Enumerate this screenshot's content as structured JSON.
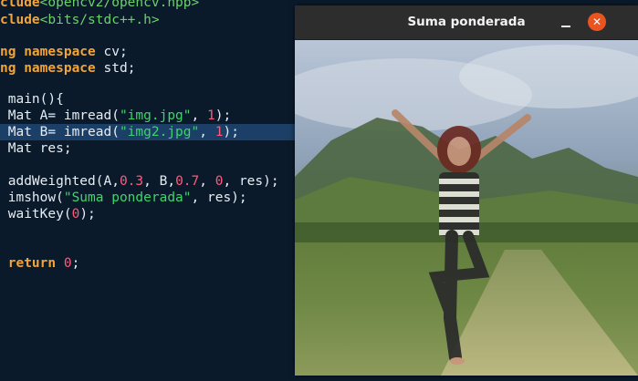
{
  "window": {
    "title": "Suma ponderada",
    "minimize_glyph": "–",
    "close_glyph": "✕",
    "close_color": "#e95420",
    "image_description_icon": "blended-photo"
  },
  "code": {
    "lines": [
      {
        "segments": [
          {
            "t": "clude",
            "c": "kw"
          },
          {
            "t": "<opencv2/opencv.hpp>",
            "c": "inc"
          }
        ]
      },
      {
        "segments": [
          {
            "t": "clude",
            "c": "kw"
          },
          {
            "t": "<bits/stdc++.h>",
            "c": "inc"
          }
        ]
      },
      {
        "segments": []
      },
      {
        "segments": [
          {
            "t": "ng ",
            "c": "kw"
          },
          {
            "t": "namespace ",
            "c": "kw"
          },
          {
            "t": "cv;",
            "c": "plain"
          }
        ]
      },
      {
        "segments": [
          {
            "t": "ng ",
            "c": "kw"
          },
          {
            "t": "namespace ",
            "c": "kw"
          },
          {
            "t": "std;",
            "c": "plain"
          }
        ]
      },
      {
        "segments": []
      },
      {
        "segments": [
          {
            "t": " main(){",
            "c": "plain"
          }
        ]
      },
      {
        "segments": [
          {
            "t": " Mat A= imread(",
            "c": "plain"
          },
          {
            "t": "\"img.jpg\"",
            "c": "str"
          },
          {
            "t": ", ",
            "c": "plain"
          },
          {
            "t": "1",
            "c": "num"
          },
          {
            "t": ");",
            "c": "plain"
          }
        ]
      },
      {
        "segments": [
          {
            "t": " Mat B= imread(",
            "c": "plain"
          },
          {
            "t": "\"img2.jpg\"",
            "c": "str"
          },
          {
            "t": ", ",
            "c": "plain"
          },
          {
            "t": "1",
            "c": "num"
          },
          {
            "t": ");",
            "c": "plain"
          }
        ],
        "highlight": true
      },
      {
        "segments": [
          {
            "t": " Mat res;",
            "c": "plain"
          }
        ]
      },
      {
        "segments": []
      },
      {
        "segments": [
          {
            "t": " addWeighted(A,",
            "c": "plain"
          },
          {
            "t": "0.3",
            "c": "num"
          },
          {
            "t": ", B,",
            "c": "plain"
          },
          {
            "t": "0.7",
            "c": "num"
          },
          {
            "t": ", ",
            "c": "plain"
          },
          {
            "t": "0",
            "c": "num"
          },
          {
            "t": ", res);",
            "c": "plain"
          }
        ]
      },
      {
        "segments": [
          {
            "t": " imshow(",
            "c": "plain"
          },
          {
            "t": "\"Suma ponderada\"",
            "c": "str"
          },
          {
            "t": ", res);",
            "c": "plain"
          }
        ]
      },
      {
        "segments": [
          {
            "t": " waitKey(",
            "c": "plain"
          },
          {
            "t": "0",
            "c": "num"
          },
          {
            "t": ");",
            "c": "plain"
          }
        ]
      },
      {
        "segments": []
      },
      {
        "segments": []
      },
      {
        "segments": [
          {
            "t": " ",
            "c": "plain"
          },
          {
            "t": "return ",
            "c": "kw"
          },
          {
            "t": "0",
            "c": "num"
          },
          {
            "t": ";",
            "c": "plain"
          }
        ]
      }
    ]
  },
  "colors": {
    "editor_bg": "#0b1a2b",
    "line_highlight": "#1b3f66",
    "keyword": "#f0a43a",
    "string": "#3cd66a",
    "number": "#ff5a7a"
  }
}
